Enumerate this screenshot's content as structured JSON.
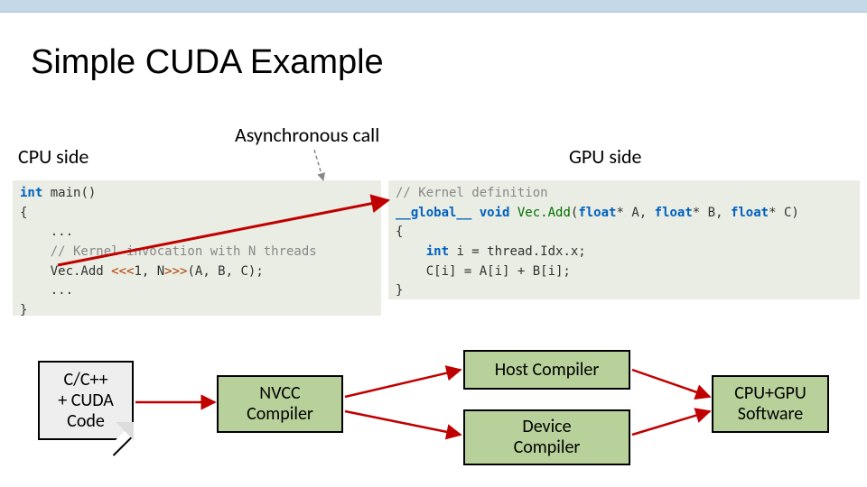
{
  "title": "Simple CUDA Example",
  "labels": {
    "cpu_side": "CPU side",
    "gpu_side": "GPU side",
    "async_call": "Asynchronous call"
  },
  "code": {
    "cpu": {
      "l1a": "int",
      "l1b": " main()",
      "l2": "{",
      "l3": "    ...",
      "l4": "    // Kernel invocation with N threads",
      "l5a": "    Vec.Add ",
      "l5b": "<<<",
      "l5c": "1, N",
      "l5d": ">>>",
      "l5e": "(A, B, C);",
      "l6": "    ...",
      "l7": "}"
    },
    "gpu": {
      "l1": "// Kernel definition",
      "l2a": "__global__",
      "l2b": " void",
      "l2c": " Vec.Add",
      "l2d": "(",
      "l2e": "float",
      "l2f": "* A, ",
      "l2g": "float",
      "l2h": "* B, ",
      "l2i": "float",
      "l2j": "* C)",
      "l3": "{",
      "l4a": "    int",
      "l4b": " i = thread.Idx.x;",
      "l5": "    C[i] = A[i] + B[i];",
      "l6": "}"
    }
  },
  "flow": {
    "code": "C/C++\n+ CUDA\nCode",
    "nvcc": "NVCC\nCompiler",
    "host": "Host Compiler",
    "device": "Device\nCompiler",
    "output": "CPU+GPU\nSoftware"
  }
}
